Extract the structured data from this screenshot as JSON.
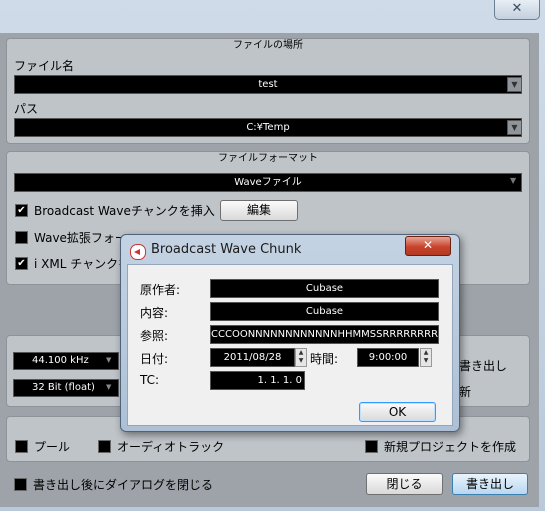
{
  "window": {
    "close_glyph": "✕"
  },
  "location": {
    "title": "ファイルの場所",
    "filename_label": "ファイル名",
    "filename_value": "test",
    "path_label": "パス",
    "path_value": "C:¥Temp"
  },
  "format": {
    "title": "ファイルフォーマット",
    "type_value": "Waveファイル",
    "bwf_label": "Broadcast Waveチャンクを挿入",
    "edit_button": "編集",
    "wave_ext_label": "Wave拡張フォー",
    "ixml_label": "i XML チャンクを"
  },
  "settings": {
    "sample_rate": "44.100 kHz",
    "bit_depth": "32 Bit (float)",
    "right_text_1": "書き出し",
    "right_text_2": "新"
  },
  "import": {
    "pool_label": "プール",
    "audio_track_label": "オーディオトラック",
    "new_project_label": "新規プロジェクトを作成"
  },
  "footer": {
    "close_after_label": "書き出し後にダイアログを閉じる",
    "close_button": "閉じる",
    "export_button": "書き出し"
  },
  "dialog": {
    "title": "Broadcast Wave Chunk",
    "close_glyph": "✕",
    "author_label": "原作者:",
    "author_value": "Cubase",
    "desc_label": "内容:",
    "desc_value": "Cubase",
    "ref_label": "参照:",
    "ref_value": "CCCOONNNNNNNNNNNNHHMMSSRRRRRRRRR",
    "date_label": "日付:",
    "date_value": "2011/08/28",
    "time_label": "時間:",
    "time_value": "9:00:00",
    "tc_label": "TC:",
    "tc_value": "1. 1. 1.   0",
    "ok_button": "OK"
  }
}
